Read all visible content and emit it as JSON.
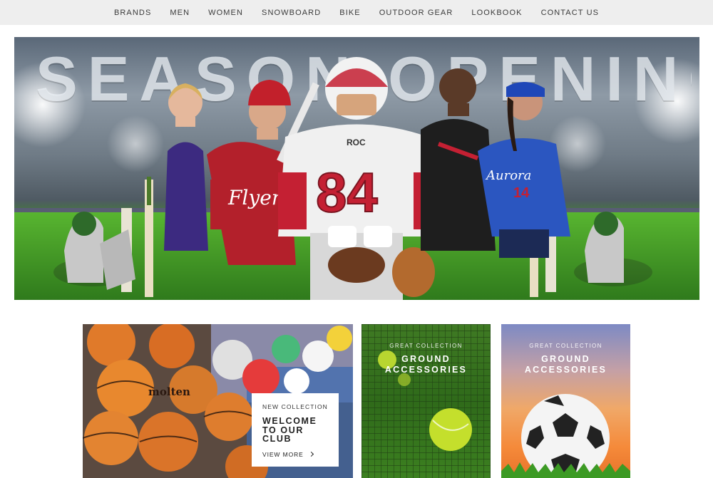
{
  "nav": {
    "items": [
      "BRANDS",
      "MEN",
      "WOMEN",
      "SNOWBOARD",
      "BIKE",
      "OUTDOOR GEAR",
      "LOOKBOOK",
      "CONTACT US"
    ]
  },
  "hero": {
    "title": "SEASON OPENING!",
    "jerseys": {
      "ballplayer": "Flyers",
      "football": "84",
      "football_brand": "ROC",
      "softball": "Aurora",
      "softball_number": "14"
    }
  },
  "cards": {
    "welcome": {
      "kicker": "NEW COLLECTION",
      "title": "WELCOME TO OUR CLUB",
      "link": "VIEW MORE"
    },
    "tennis": {
      "kicker": "GREAT COLLECTION",
      "title": "GROUND ACCESSORIES"
    },
    "soccer": {
      "kicker": "GREAT COLLECTION",
      "title": "GROUND ACCESSORIES"
    },
    "ball_brand": "molten"
  },
  "colors": {
    "nav_bg": "#eeeeee",
    "nav_text": "#3a3a3a",
    "grass": "#4ea82c",
    "welcome_bg": "#ffffff"
  }
}
